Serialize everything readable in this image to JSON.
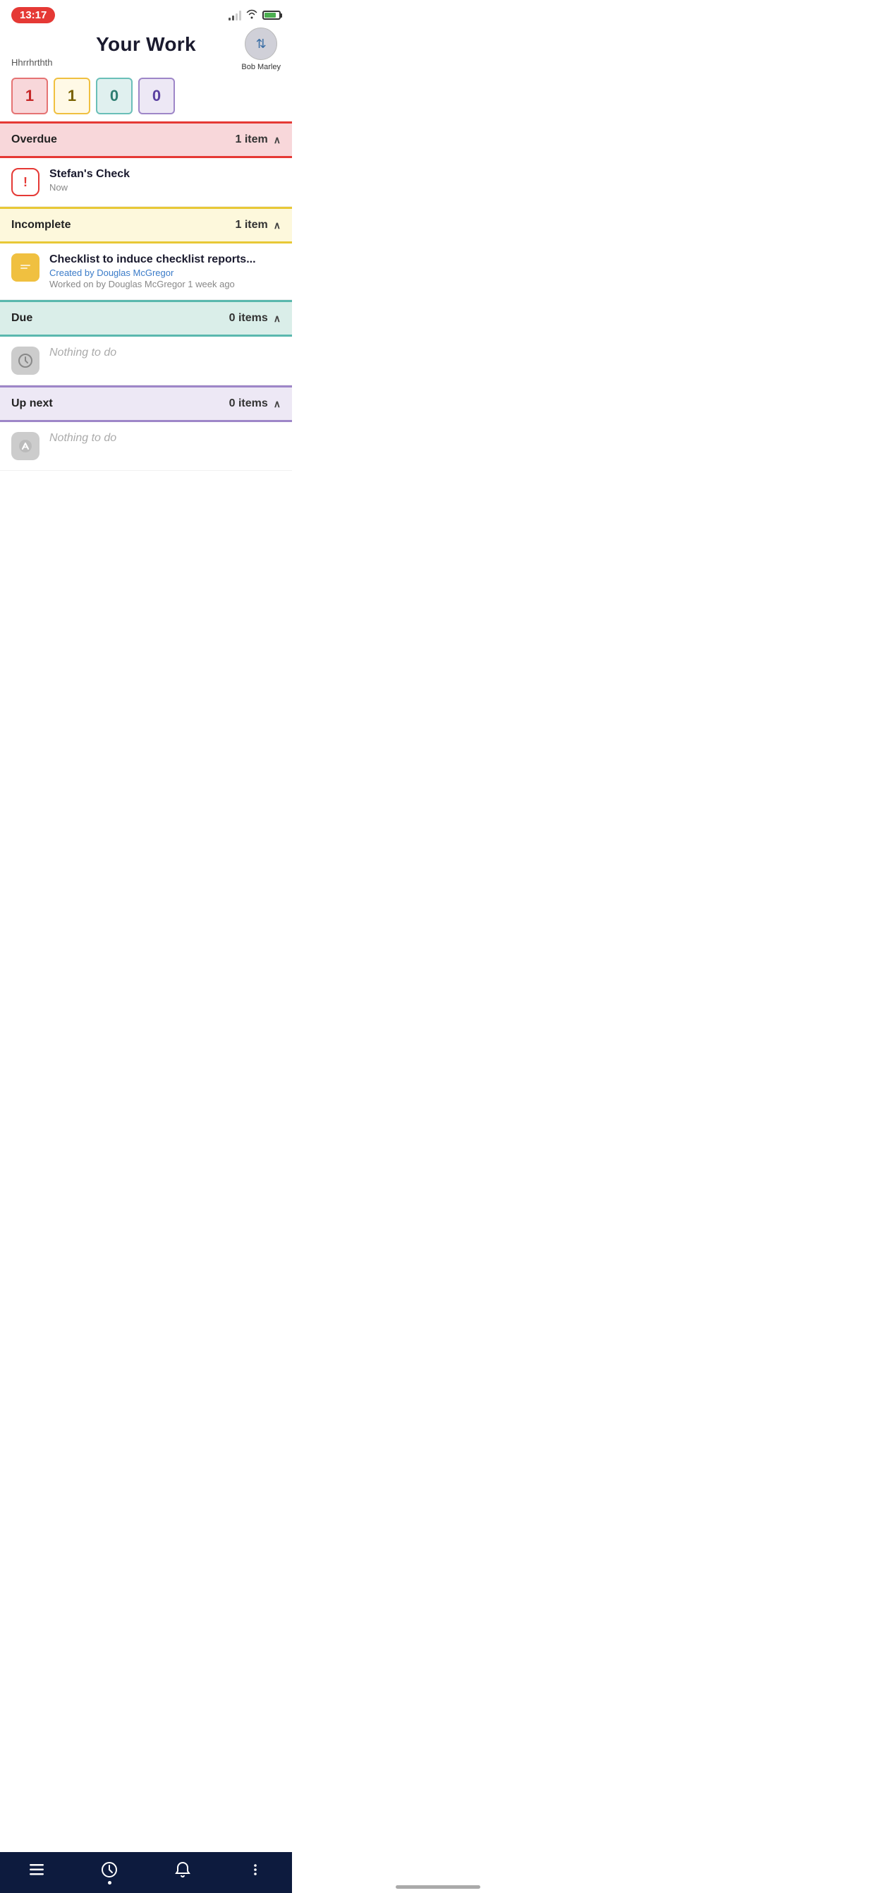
{
  "statusBar": {
    "time": "13:17"
  },
  "header": {
    "title": "Your Work",
    "subtitle": "Hhrrhrthth",
    "user": {
      "name": "Bob Marley"
    }
  },
  "counters": [
    {
      "value": "1",
      "type": "overdue",
      "label": "Overdue"
    },
    {
      "value": "1",
      "type": "incomplete",
      "label": "Incomplete"
    },
    {
      "value": "0",
      "type": "due",
      "label": "Due"
    },
    {
      "value": "0",
      "type": "upnext",
      "label": "Up next"
    }
  ],
  "sections": {
    "overdue": {
      "label": "Overdue",
      "count": "1 item",
      "items": [
        {
          "title": "Stefan's Check",
          "timestamp": "Now",
          "iconType": "overdue"
        }
      ]
    },
    "incomplete": {
      "label": "Incomplete",
      "count": "1 item",
      "items": [
        {
          "title": "Checklist to induce checklist reports...",
          "creator": "Created by Douglas McGregor",
          "worked": "Worked on by Douglas McGregor 1 week ago",
          "iconType": "checklist"
        }
      ]
    },
    "due": {
      "label": "Due",
      "count": "0 items",
      "items": [],
      "emptyText": "Nothing to do"
    },
    "upnext": {
      "label": "Up next",
      "count": "0 items",
      "items": [],
      "emptyText": "Nothing to do"
    }
  },
  "bottomNav": {
    "items": [
      {
        "icon": "list",
        "label": "List",
        "active": false
      },
      {
        "icon": "clock",
        "label": "Work",
        "active": true
      },
      {
        "icon": "bell",
        "label": "Notifications",
        "active": false
      },
      {
        "icon": "more",
        "label": "More",
        "active": false
      }
    ]
  }
}
